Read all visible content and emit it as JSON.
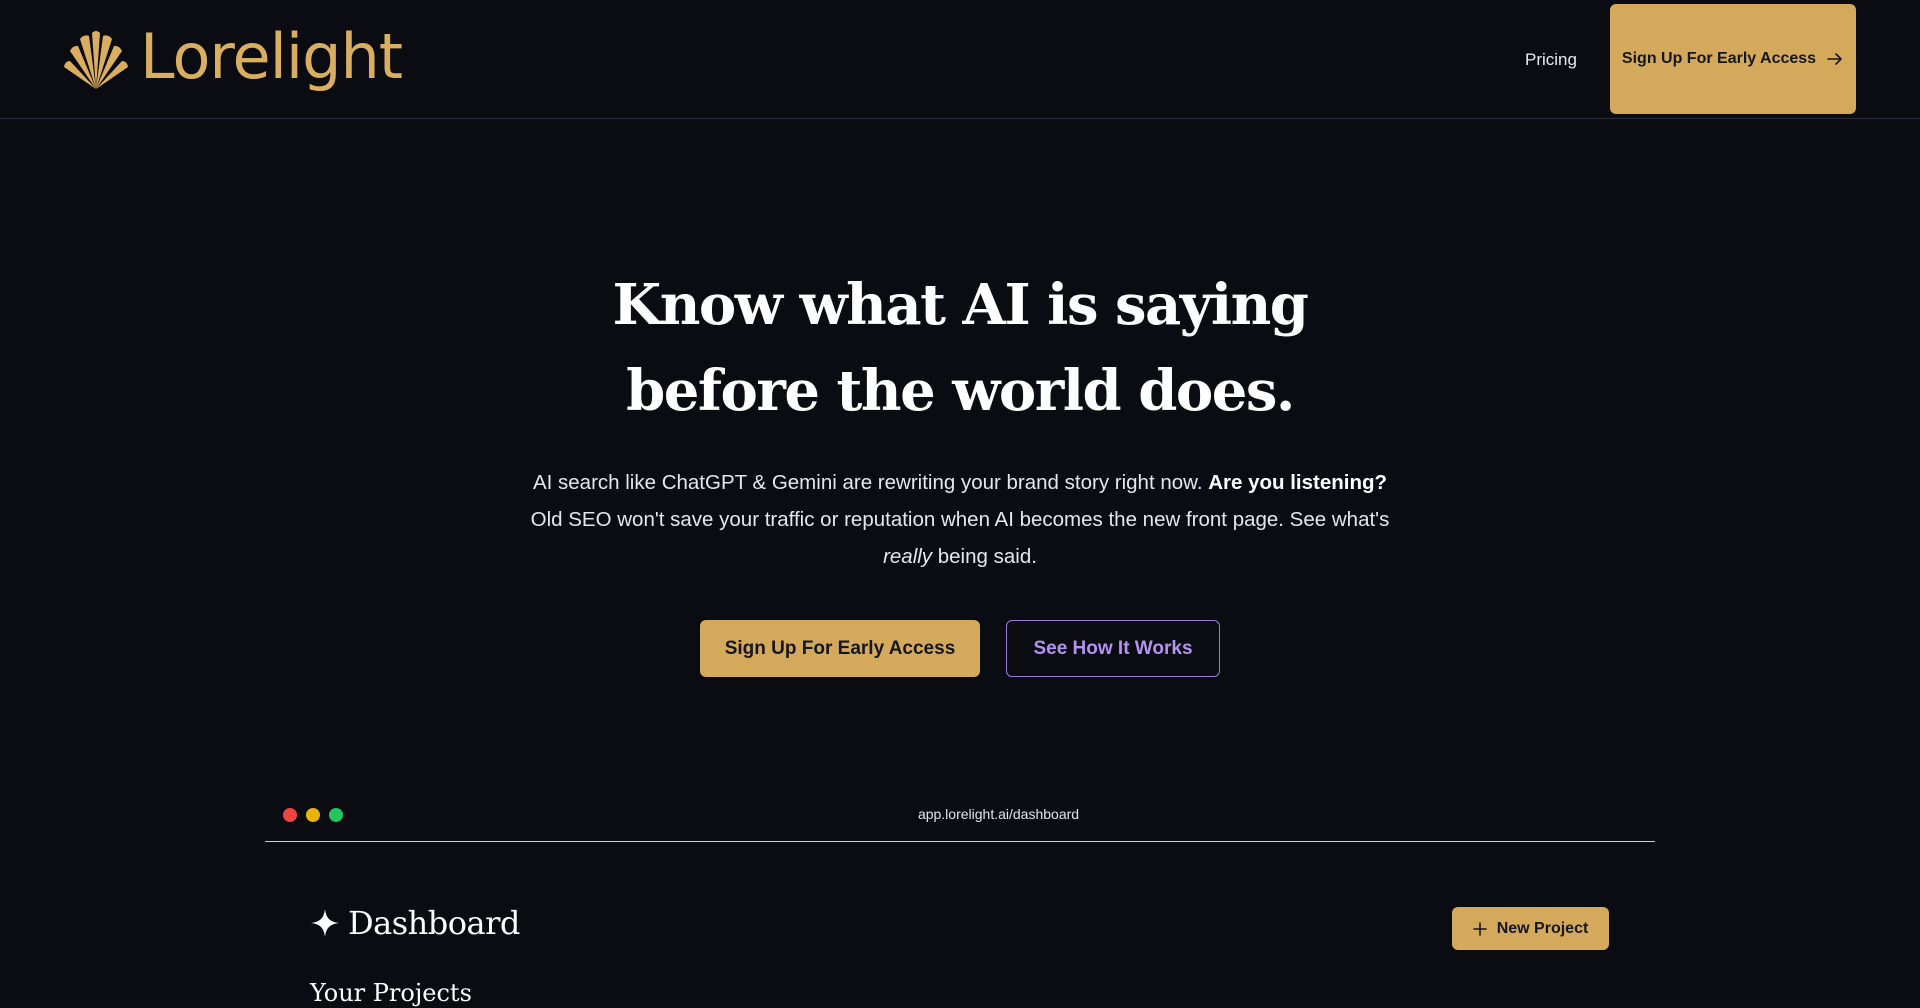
{
  "brand": {
    "name": "Lorelight",
    "accent_color": "#d4a95c",
    "background_color": "#0b0c12",
    "secondary_accent_color": "#9a7ad6"
  },
  "header": {
    "nav": [
      {
        "label": "Pricing"
      }
    ],
    "cta_label": "Sign Up For Early Access",
    "cta_icon": "arrow-right-icon"
  },
  "hero": {
    "title_line1": "Know what AI is saying",
    "title_line2": "before the world does.",
    "subtitle": {
      "part1": "AI search like ChatGPT & Gemini are rewriting your brand story right now. ",
      "bold": "Are you listening?",
      "part2": " Old SEO won't save your traffic or reputation when AI becomes the new front page. See what's ",
      "italic": "really",
      "part3": " being said."
    },
    "primary_button": "Sign Up For Early Access",
    "secondary_button": "See How It Works"
  },
  "browser_mock": {
    "url": "app.lorelight.ai/dashboard",
    "window_dots": [
      "#ef4444",
      "#eab308",
      "#22c55e"
    ]
  },
  "dashboard": {
    "title": "Dashboard",
    "title_icon": "sparkle-icon",
    "new_project_label": "New Project",
    "new_project_icon": "plus-icon",
    "section_heading": "Your Projects"
  }
}
